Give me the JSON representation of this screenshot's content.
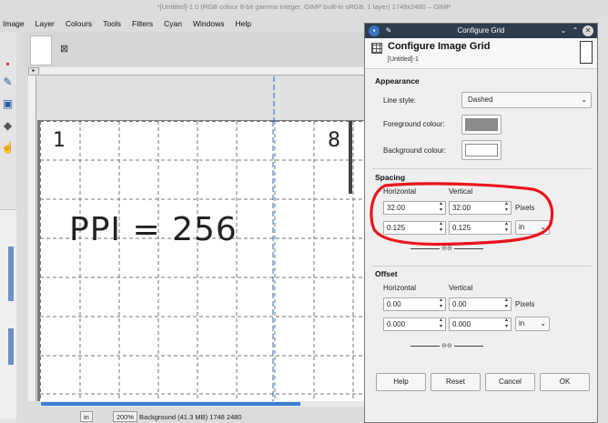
{
  "window_title": "*[Untitled]-1.0 (RGB colour 8-bit gamma integer, GIMP built-in sRGB, 1 layer) 1748x2480 – GIMP",
  "menubar": [
    "Image",
    "Layer",
    "Colours",
    "Tools",
    "Filters",
    "Cyan",
    "Windows",
    "Help"
  ],
  "canvas": {
    "handwriting_main": "PPI = 256",
    "corner_left": "1",
    "corner_right": "8"
  },
  "statusbar": {
    "unit": "in",
    "zoom": "200%",
    "info": "Background (41.3 MB) 1748 2480"
  },
  "dialog": {
    "titlebar": "Configure Grid",
    "header_title": "Configure Image Grid",
    "header_subtitle": "[Untitled]-1",
    "appearance": {
      "section": "Appearance",
      "line_style_label": "Line style:",
      "line_style_value": "Dashed",
      "fg_label": "Foreground colour:",
      "fg_color": "#8a8a8a",
      "bg_label": "Background colour:",
      "bg_color": "#ffffff"
    },
    "spacing": {
      "section": "Spacing",
      "horizontal_label": "Horizontal",
      "vertical_label": "Vertical",
      "h_pixels": "32.00",
      "v_pixels": "32.00",
      "pixels_unit": "Pixels",
      "h_inch": "0.125",
      "v_inch": "0.125",
      "inch_unit": "in"
    },
    "offset": {
      "section": "Offset",
      "horizontal_label": "Horizontal",
      "vertical_label": "Vertical",
      "h_pixels": "0.00",
      "v_pixels": "0.00",
      "pixels_unit": "Pixels",
      "h_inch": "0.000",
      "v_inch": "0.000",
      "inch_unit": "in"
    },
    "buttons": {
      "help": "Help",
      "reset": "Reset",
      "cancel": "Cancel",
      "ok": "OK"
    }
  },
  "colors": {
    "annotation_red": "#e8141a",
    "guide_blue": "#2a62c4",
    "titlebar_dark": "#2f3c4e"
  }
}
